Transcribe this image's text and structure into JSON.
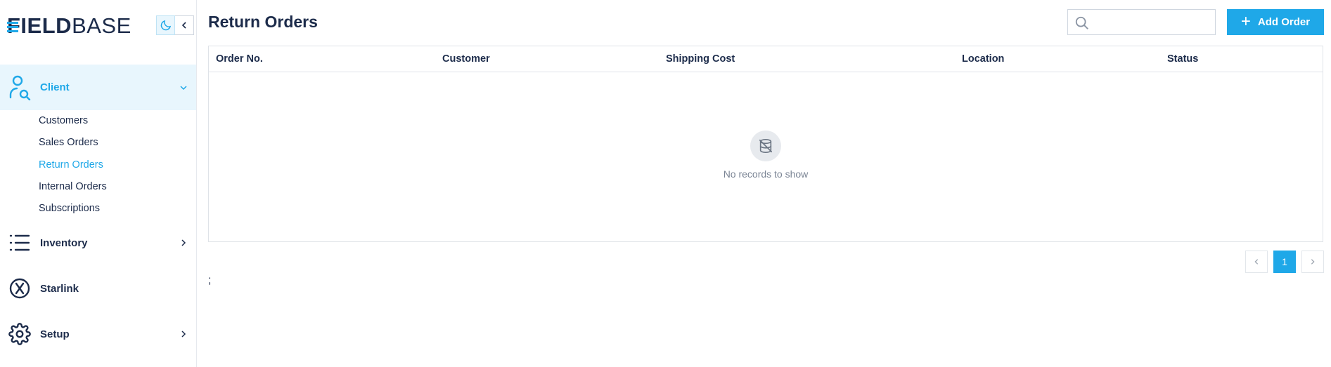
{
  "brand": {
    "logo_bold": "FIELD",
    "logo_light": "BASE",
    "accent": "#1fa8e8",
    "text": "#1c2b4a"
  },
  "sidebar": {
    "groups": [
      {
        "label": "Client",
        "icon": "user-search-icon",
        "expanded": true
      },
      {
        "label": "Inventory",
        "icon": "list-icon",
        "expanded": false
      },
      {
        "label": "Starlink",
        "icon": "x-circle-icon",
        "expanded": false
      },
      {
        "label": "Setup",
        "icon": "gear-icon",
        "expanded": false
      }
    ],
    "client_items": [
      {
        "label": "Customers",
        "active": false
      },
      {
        "label": "Sales Orders",
        "active": false
      },
      {
        "label": "Return Orders",
        "active": true
      },
      {
        "label": "Internal Orders",
        "active": false
      },
      {
        "label": "Subscriptions",
        "active": false
      }
    ]
  },
  "header": {
    "title": "Return Orders",
    "search_placeholder": "",
    "search_value": "",
    "add_button_label": "Add Order"
  },
  "table": {
    "columns": [
      "Order No.",
      "Customer",
      "Shipping Cost",
      "Location",
      "Status"
    ],
    "rows": [],
    "empty_text": "No records to show"
  },
  "pagination": {
    "current_page": "1",
    "prev": "‹",
    "next": "›"
  },
  "stray_text": ";"
}
